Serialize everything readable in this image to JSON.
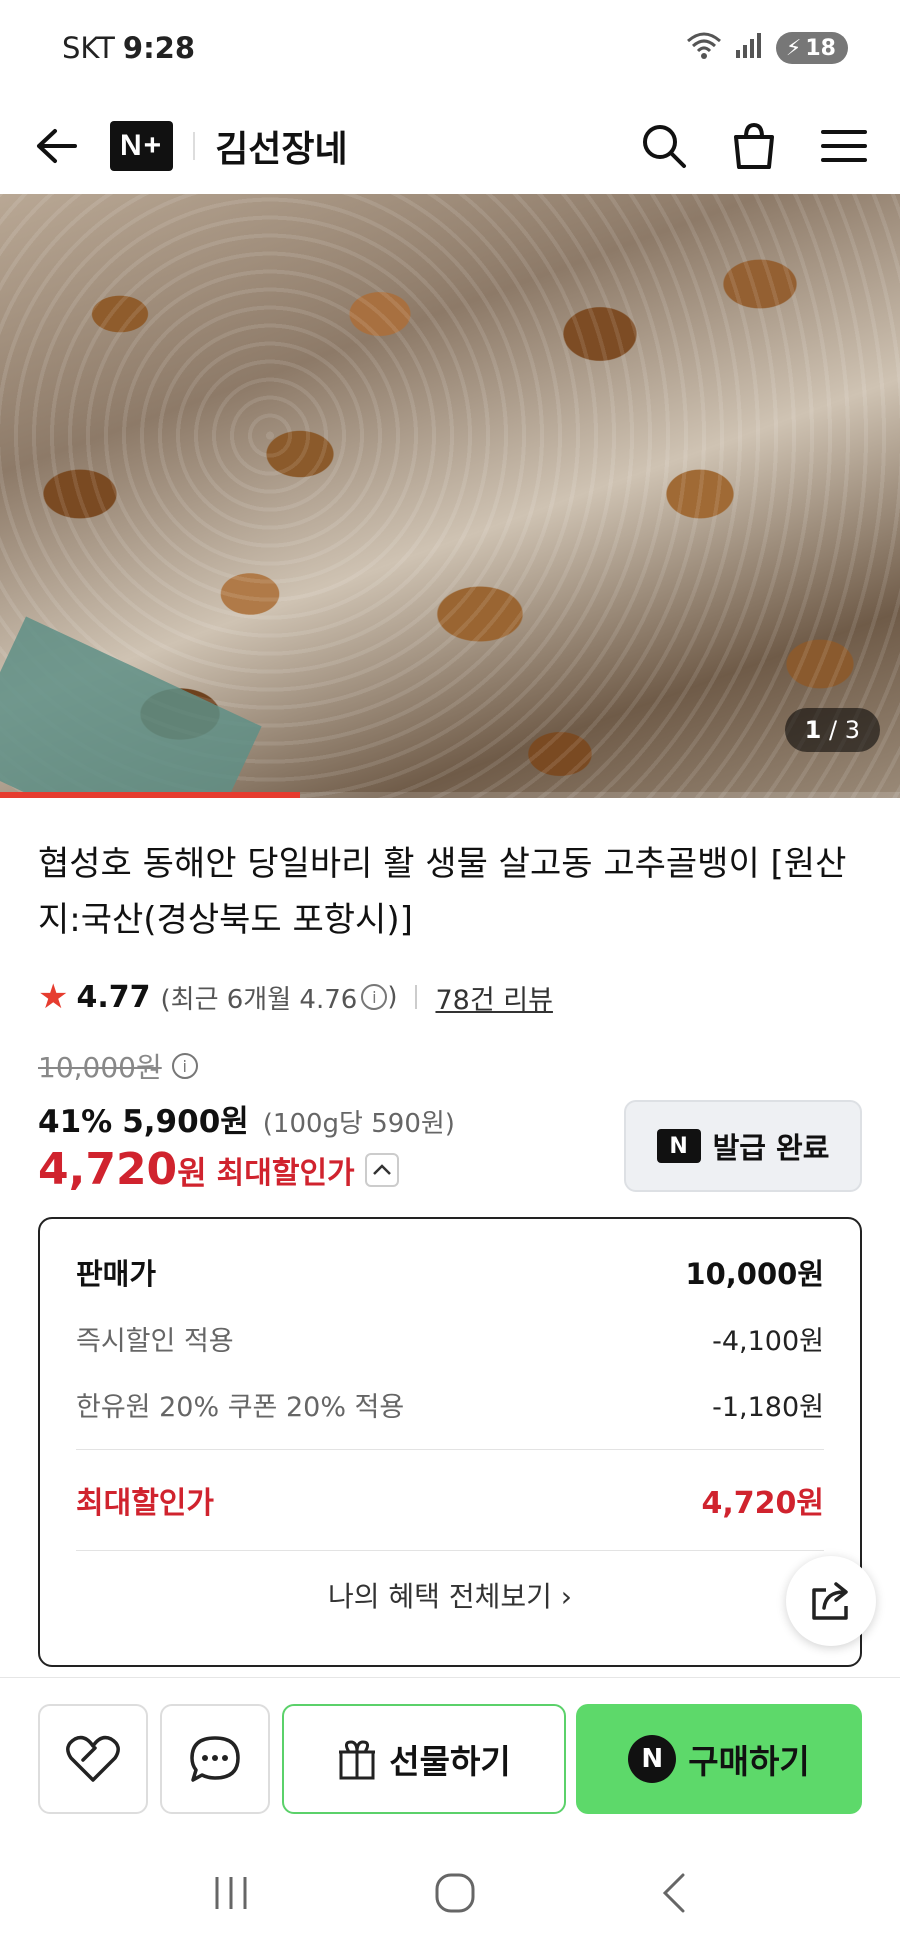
{
  "status_bar": {
    "carrier": "SKT",
    "time": "9:28",
    "battery": "18"
  },
  "header": {
    "logo_text": "N+",
    "store_name": "김선장네"
  },
  "hero": {
    "page_current": "1",
    "page_total": "/ 3",
    "progress_fraction": 0.333
  },
  "product": {
    "title": "협성호 동해안 당일바리 활 생물 살고동 고추골뱅이 [원산지:국산(경상북도 포항시)]",
    "rating": "4.77",
    "rating_recent": "(최근 6개월 4.76",
    "rating_recent_close": ")",
    "review_link": "78건 리뷰",
    "original_price": "10,000원",
    "discount_pct": "41%",
    "sale_price": "5,900원",
    "unit_price": "(100g당 590원)",
    "max_price_number": "4,720",
    "max_price_unit": "원",
    "max_label": "최대할인가"
  },
  "coupon": {
    "badge": "N",
    "label": "발급 완료"
  },
  "breakdown": {
    "sale_label": "판매가",
    "sale_value": "10,000원",
    "instant_label": "즉시할인 적용",
    "instant_value": "-4,100원",
    "coupon_label": "한유원 20% 쿠폰 20% 적용",
    "coupon_value": "-1,180원",
    "max_label": "최대할인가",
    "max_value": "4,720원",
    "benefits_link": "나의 혜택 전체보기 ›"
  },
  "bottom_bar": {
    "gift_label": "선물하기",
    "buy_badge": "N",
    "buy_label": "구매하기"
  },
  "colors": {
    "accent_red": "#d0232e",
    "buy_green": "#5dd96a"
  }
}
